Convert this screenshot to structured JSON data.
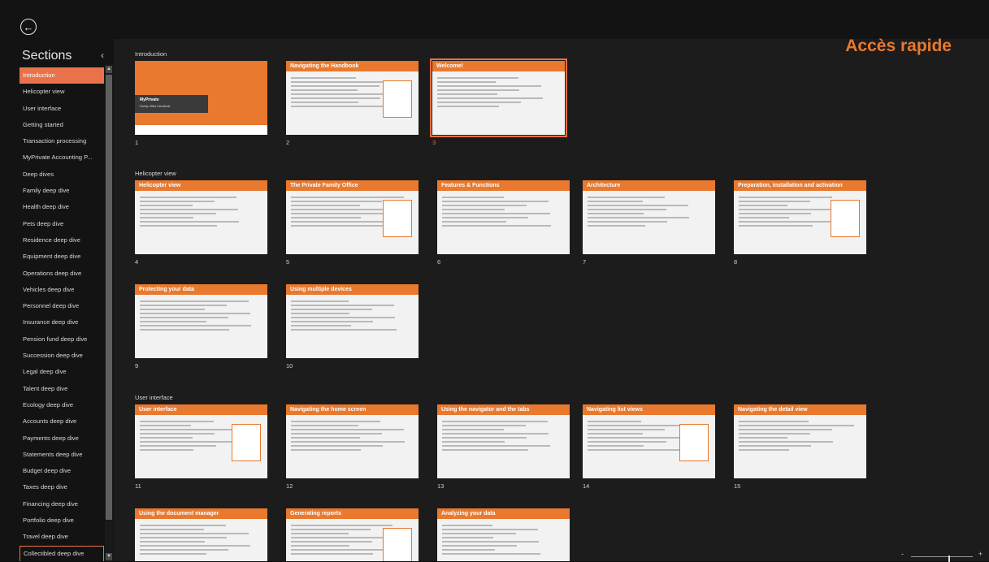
{
  "header": {
    "quick_access": "Accès rapide"
  },
  "sidebar": {
    "title": "Sections",
    "items": [
      "Introduction",
      "Helicopter view",
      "User interface",
      "Getting started",
      "Transaction processing",
      "MyPrivate Accounting P...",
      "Deep dives",
      "Family deep dive",
      "Health deep dive",
      "Pets deep dive",
      "Residence deep dive",
      "Equipment deep dive",
      "Operations deep dive",
      "Vehicles deep dive",
      "Personnel deep dive",
      "Insurance deep dive",
      "Pension fund deep dive",
      "Succession deep dive",
      "Legal deep dive",
      "Talent deep dive",
      "Ecology deep dive",
      "Accounts deep dive",
      "Payments deep dive",
      "Statements deep dive",
      "Budget deep dive",
      "Taxes deep dive",
      "Financing deep dive",
      "Portfolio deep dive",
      "Travel deep dive",
      "Collectibled deep dive"
    ]
  },
  "sections": [
    {
      "label": "Introduction",
      "slides": [
        {
          "num": "1",
          "title": "",
          "cover_title": "MyPrivate",
          "cover_sub": "Family Office Handbook"
        },
        {
          "num": "2",
          "title": "Navigating the Handbook"
        },
        {
          "num": "3",
          "title": "Welcome!"
        }
      ]
    },
    {
      "label": "Helicopter view",
      "slides": [
        {
          "num": "4",
          "title": "Helicopter view"
        },
        {
          "num": "5",
          "title": "The Private Family Office"
        },
        {
          "num": "6",
          "title": "Features & Functions"
        },
        {
          "num": "7",
          "title": "Architecture"
        },
        {
          "num": "8",
          "title": "Preparation, installation and activation"
        },
        {
          "num": "9",
          "title": "Protecting your data"
        },
        {
          "num": "10",
          "title": "Using multiple devices"
        }
      ]
    },
    {
      "label": "User interface",
      "slides": [
        {
          "num": "11",
          "title": "User interface"
        },
        {
          "num": "12",
          "title": "Navigating the home screen"
        },
        {
          "num": "13",
          "title": "Using the navigator and the tabs"
        },
        {
          "num": "14",
          "title": "Navigating list views"
        },
        {
          "num": "15",
          "title": "Navigating the detail view"
        },
        {
          "num": "",
          "title": "Using the document manager"
        },
        {
          "num": "",
          "title": "Generating reports"
        },
        {
          "num": "",
          "title": "Analyzing your data"
        }
      ]
    }
  ],
  "zoom": {
    "minus": "-",
    "plus": "+"
  },
  "grid_numbers": [
    "01",
    "02",
    "03",
    "04",
    "05",
    "06",
    "07",
    "08",
    "09",
    "10",
    "11",
    "12"
  ],
  "colors": {
    "accent": "#e8792e",
    "selection": "#e86f45",
    "background": "#131313"
  },
  "icons": {
    "back": "back-arrow-circle-icon",
    "collapse": "chevron-left-icon"
  }
}
